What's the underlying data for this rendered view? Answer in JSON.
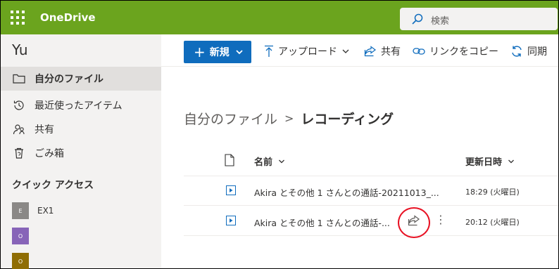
{
  "app": {
    "brand": "OneDrive"
  },
  "search": {
    "placeholder": "検索"
  },
  "user": {
    "name": "Yu"
  },
  "nav": {
    "items": [
      {
        "label": "自分のファイル",
        "icon": "folder-icon",
        "active": true
      },
      {
        "label": "最近使ったアイテム",
        "icon": "history-icon",
        "active": false
      },
      {
        "label": "共有",
        "icon": "people-icon",
        "active": false
      },
      {
        "label": "ごみ箱",
        "icon": "recycle-bin-icon",
        "active": false
      }
    ],
    "quick_access_title": "クイック アクセス",
    "quick_access": [
      {
        "label": "EX1",
        "badge": "E",
        "color": "#8a8886"
      },
      {
        "label": "",
        "badge": "O",
        "color": "#8764b8"
      },
      {
        "label": "",
        "badge": "O",
        "color": "#8f6d04"
      }
    ]
  },
  "commands": {
    "new_label": "新規",
    "upload_label": "アップロード",
    "share_label": "共有",
    "copy_link_label": "リンクをコピー",
    "sync_label": "同期"
  },
  "breadcrumb": {
    "parent": "自分のファイル",
    "current": "レコーディング"
  },
  "table": {
    "col_name": "名前",
    "col_modified": "更新日時",
    "rows": [
      {
        "name": "Akira とその他 1 さんとの通話-20211013_...",
        "modified": "18:29 (火曜日)"
      },
      {
        "name": "Akira とその他 1 さんとの通話-...",
        "modified": "20:12 (火曜日)"
      }
    ]
  },
  "colors": {
    "brand_bar": "#6ba41e",
    "primary": "#0f6cbd",
    "highlight_circle": "#e81123"
  }
}
